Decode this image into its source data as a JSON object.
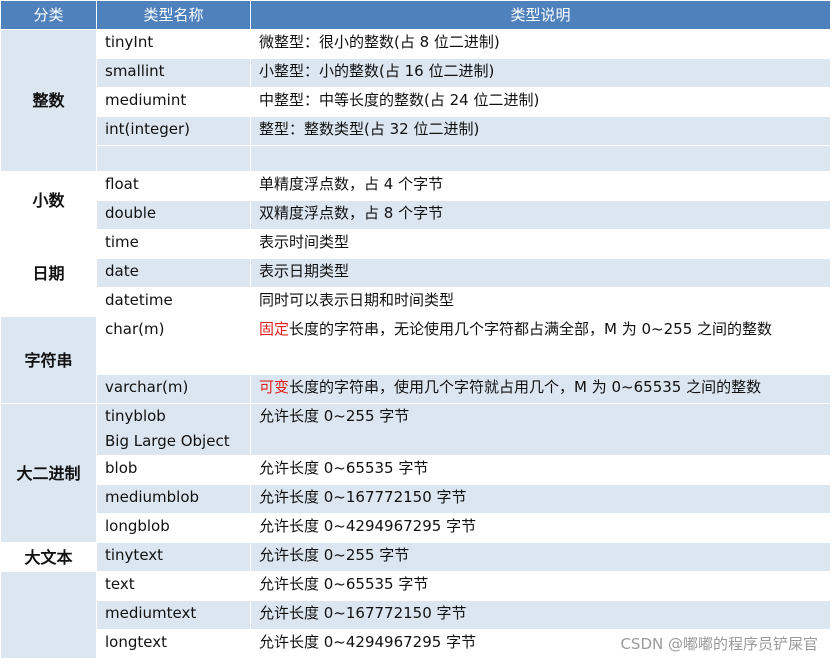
{
  "header": {
    "category": "分类",
    "type_name": "类型名称",
    "description": "类型说明"
  },
  "groups": [
    {
      "category": "整数",
      "rows": [
        {
          "name": [
            "tinyInt"
          ],
          "desc": "微整型：很小的整数(占 8 位二进制)"
        },
        {
          "name": [
            "smallint"
          ],
          "desc": "小整型：小的整数(占 16 位二进制)"
        },
        {
          "name": [
            "mediumint"
          ],
          "desc": "中整型：中等长度的整数(占 24 位二进制)"
        },
        {
          "name": [
            "int(integer)"
          ],
          "desc": "整型：整数类型(占 32 位二进制)"
        },
        {
          "name": [
            ""
          ],
          "desc": ""
        }
      ]
    },
    {
      "category": "小数",
      "rows": [
        {
          "name": [
            "float"
          ],
          "desc": "单精度浮点数，占 4 个字节"
        },
        {
          "name": [
            "double"
          ],
          "desc": "双精度浮点数，占 8 个字节"
        }
      ]
    },
    {
      "category": "日期",
      "rows": [
        {
          "name": [
            "time"
          ],
          "desc": "表示时间类型"
        },
        {
          "name": [
            "date"
          ],
          "desc": "表示日期类型"
        },
        {
          "name": [
            "datetime"
          ],
          "desc": "同时可以表示日期和时间类型"
        }
      ]
    },
    {
      "category": "字符串",
      "rows": [
        {
          "name": [
            "char(m)"
          ],
          "desc_highlight": "固定",
          "desc": "长度的字符串，无论使用几个字符都占满全部，M 为 0~255 之间的整数"
        },
        {
          "name": [
            "varchar(m)"
          ],
          "desc_highlight": "可变",
          "desc": "长度的字符串，使用几个字符就占用几个，M 为 0~65535 之间的整数"
        }
      ]
    },
    {
      "category": "大二进制",
      "rows": [
        {
          "name": [
            "tinyblob",
            "Big Large Object"
          ],
          "desc": "允许长度 0~255 字节"
        },
        {
          "name": [
            "blob"
          ],
          "desc": "允许长度 0~65535 字节"
        },
        {
          "name": [
            "mediumblob"
          ],
          "desc": "允许长度 0~167772150 字节"
        },
        {
          "name": [
            "longblob"
          ],
          "desc": "允许长度 0~4294967295 字节"
        }
      ]
    },
    {
      "category": "大文本",
      "rows": [
        {
          "name": [
            "tinytext"
          ],
          "desc": "允许长度 0~255 字节"
        }
      ]
    },
    {
      "category": "",
      "rows": [
        {
          "name": [
            "text"
          ],
          "desc": "允许长度 0~65535 字节"
        },
        {
          "name": [
            "mediumtext"
          ],
          "desc": "允许长度 0~167772150 字节"
        },
        {
          "name": [
            "longtext"
          ],
          "desc": "允许长度 0~4294967295 字节"
        }
      ]
    }
  ],
  "watermark": "CSDN @嘟嘟的程序员铲屎官",
  "colors": {
    "header_bg": "#4f81bd",
    "shade": "#dce6f1",
    "highlight": "#e0201b",
    "watermark": "#9a9a9a"
  }
}
